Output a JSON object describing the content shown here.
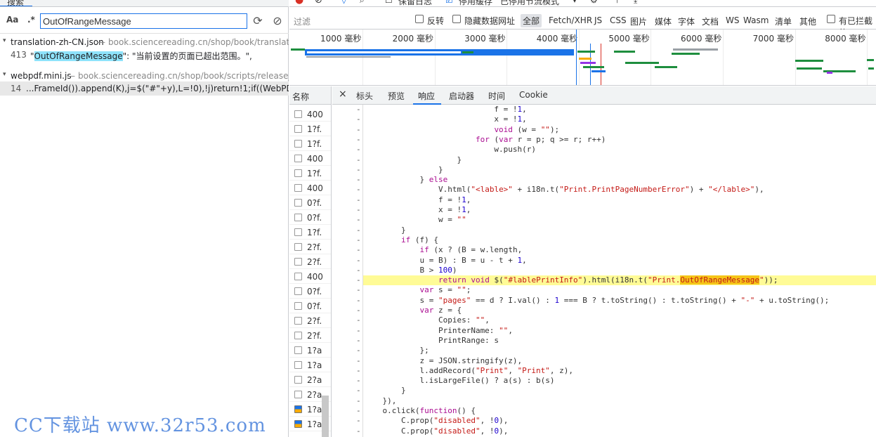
{
  "left": {
    "title": "搜索",
    "search": {
      "aa_label": "Aa",
      "regex_label": ".*",
      "value": "OutOfRangeMessage"
    },
    "results": [
      {
        "file": "translation-zh-CN.json",
        "path": "book.sciencereading.cn/shop/book/translation...",
        "match_line": "413",
        "match_pre": "\"",
        "match_hl": "OutOfRangeMessage",
        "match_post": "\": \"当前设置的页面已超出范围。\","
      },
      {
        "file": "webpdf.mini.js",
        "path": "book.sciencereading.cn/shop/book/scripts/release_we...",
        "match_line": "14",
        "match_pre": "...FrameId()).append(K),j=$(\"#\"+y),L=!0),!j)return!1;if((WebPDF.Enviro...",
        "match_hl": "",
        "match_post": ""
      }
    ]
  },
  "toolbar": {
    "preserve_log": "保留日志",
    "disable_cache": "停用缓存",
    "throttle": "已停用节流模式"
  },
  "filter": {
    "placeholder": "过滤",
    "invert": "反转",
    "hide_data_urls": "隐藏数据网址",
    "types": [
      "全部",
      "Fetch/XHR",
      "JS",
      "CSS",
      "图片",
      "媒体",
      "字体",
      "文档",
      "WS",
      "Wasm",
      "清单",
      "其他"
    ],
    "blocked": "有已拦截的"
  },
  "timeline": {
    "ticks": [
      "1000 毫秒",
      "2000 毫秒",
      "3000 毫秒",
      "4000 毫秒",
      "5000 毫秒",
      "6000 毫秒",
      "7000 毫秒",
      "8000 毫秒"
    ]
  },
  "reqlist": {
    "header": "名称",
    "items": [
      "400",
      "1?f.",
      "1?f.",
      "400",
      "1?f.",
      "400",
      "0?f.",
      "0?f.",
      "1?f.",
      "2?f.",
      "2?f.",
      "400",
      "0?f.",
      "0?f.",
      "2?f.",
      "2?f.",
      "1?a",
      "1?a",
      "2?a",
      "2?a",
      "1?a",
      "1?a"
    ]
  },
  "tabs": {
    "close": "×",
    "headers": "标头",
    "preview": "预览",
    "response": "响应",
    "initiator": "启动器",
    "timing": "时间",
    "cookie": "Cookie"
  },
  "code": {
    "lines": [
      "                            f = !1,",
      "                            x = !1,",
      "                            void (w = \"\");",
      "                        for (var r = p; q >= r; r++)",
      "                            w.push(r)",
      "                    }",
      "                }",
      "            } else",
      "                V.html(\"<lable>\" + i18n.t(\"Print.PrintPageNumberError\") + \"</lable>\"),",
      "                f = !1,",
      "                x = !1,",
      "                w = \"\"",
      "        }",
      "        if (f) {",
      "            if (x ? (B = w.length,",
      "            u = B) : B = u - t + 1,",
      "            B > 100)",
      "                return void $(\"#lablePrintInfo\").html(i18n.t(\"Print.OutOfRangeMessage\"));",
      "            var s = \"\";",
      "            s = \"pages\" == d ? I.val() : 1 === B ? t.toString() : t.toString() + \"-\" + u.toString();",
      "            var z = {",
      "                Copies: \"\",",
      "                PrinterName: \"\",",
      "                PrintRange: s",
      "            };",
      "            z = JSON.stringify(z),",
      "            l.addRecord(\"Print\", \"Print\", z),",
      "            l.isLargeFile() ? a(s) : b(s)",
      "        }",
      "    }),",
      "    o.click(function() {",
      "        C.prop(\"disabled\", !0),",
      "        C.prop(\"disabled\", !0),"
    ],
    "highlight_line": 17
  },
  "watermark": "CC下载站 www.32r53.com"
}
